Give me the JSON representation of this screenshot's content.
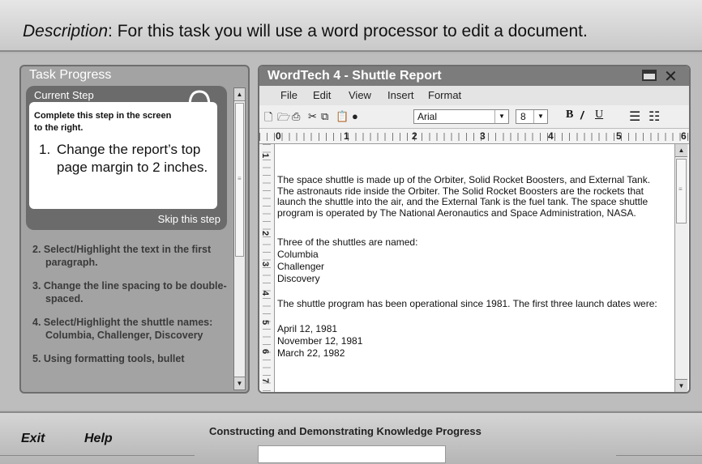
{
  "description": {
    "label": "Description",
    "text": ": For this task you will use a word processor to edit a document."
  },
  "task_panel": {
    "title": "Task Progress",
    "current_step": {
      "header": "Current Step",
      "instruction": "Complete this step in the screen to the right.",
      "step_number": "1.",
      "step_text": "Change the report’s top page margin to 2 inches.",
      "skip_label": "Skip this step"
    },
    "steps": [
      "2. Select/Highlight the text in the first paragraph.",
      "3. Change the line spacing to be double-spaced.",
      "4. Select/Highlight the shuttle names:  Columbia, Challenger, Discovery",
      "5. Using formatting tools, bullet"
    ]
  },
  "word_processor": {
    "title": "WordTech 4 - Shuttle Report",
    "menu": [
      "File",
      "Edit",
      "View",
      "Insert",
      "Format"
    ],
    "font": "Arial",
    "font_size": "8",
    "ruler_numbers": [
      "0",
      "1",
      "2",
      "3",
      "4",
      "5",
      "6"
    ],
    "vruler_numbers": [
      "1",
      "2",
      "3",
      "4",
      "5",
      "6",
      "7"
    ],
    "document": {
      "para1": "The space shuttle is made up of the Orbiter, Solid Rocket Boosters, and External Tank.  The astronauts ride inside the Orbiter. The Solid Rocket Boosters are the rockets that launch the shuttle into the air, and the External Tank is the fuel tank.  The space shuttle program is operated by The National Aeronautics and Space Administration, NASA.",
      "para2_intro": "Three of the shuttles are named:",
      "shuttles": [
        "Columbia",
        "Challenger",
        "Discovery"
      ],
      "para3_intro": "The shuttle program has been operational since 1981.  The first three launch dates were:",
      "dates": [
        "April 12, 1981",
        "November 12, 1981",
        "March 22, 1982"
      ]
    }
  },
  "bottom_bar": {
    "exit_label": "Exit",
    "help_label": "Help",
    "progress_label": "Constructing and Demonstrating Knowledge Progress",
    "progress_fraction": 0
  },
  "icons": [
    "headphone-icon",
    "new-doc-icon",
    "open-icon",
    "print-icon",
    "cut-icon",
    "copy-icon",
    "paste-icon",
    "globe-icon",
    "bold-icon",
    "italic-icon",
    "underline-icon",
    "bullet-list-icon",
    "numbered-list-icon",
    "maximize-icon",
    "close-icon"
  ]
}
